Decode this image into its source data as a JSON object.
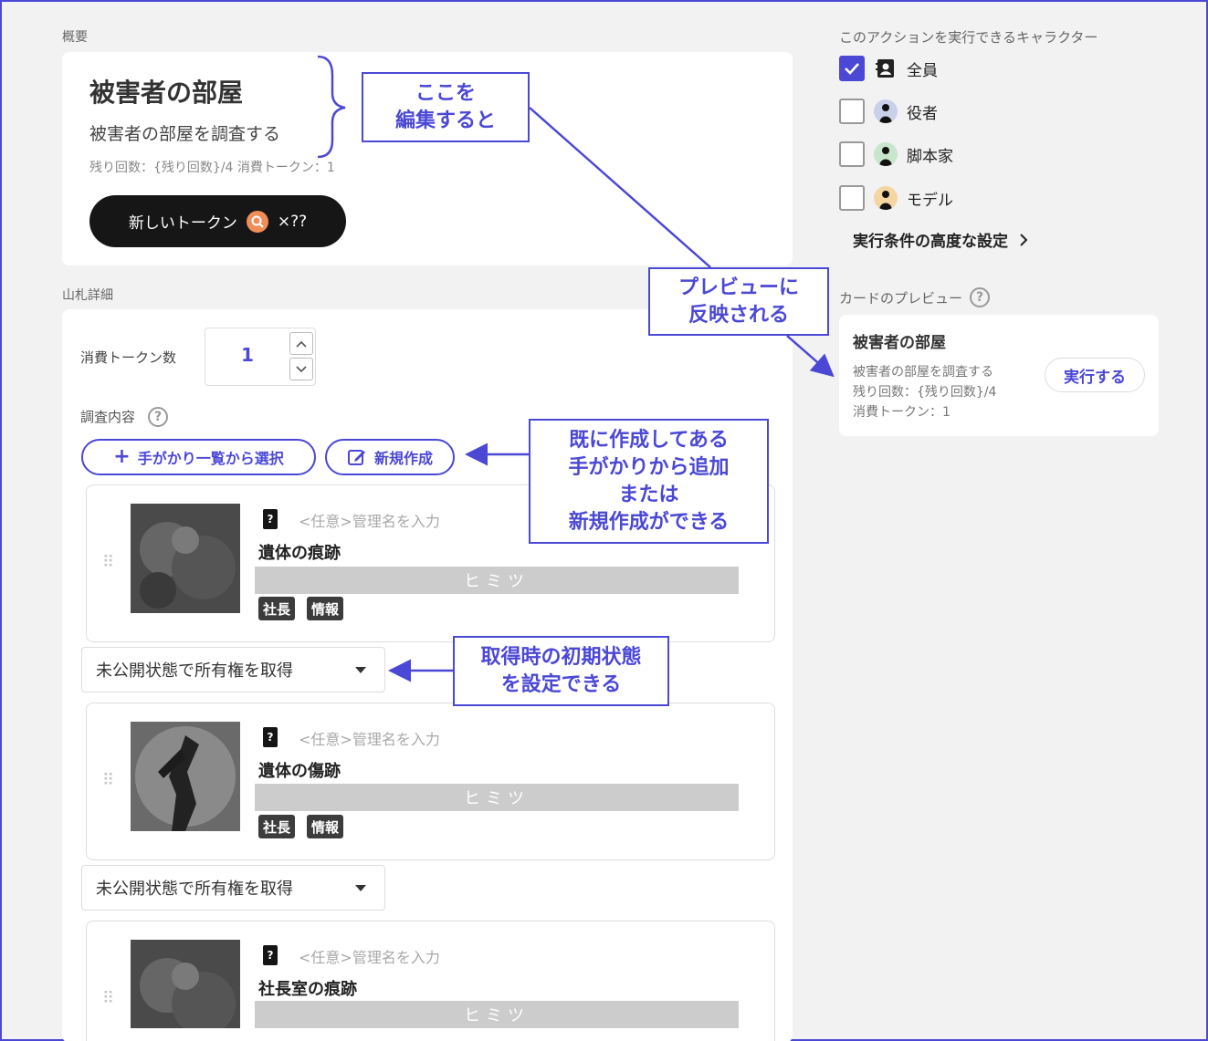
{
  "overview": {
    "section_label": "概要",
    "title": "被害者の部屋",
    "description": "被害者の部屋を調査する",
    "meta": "残り回数：{残り回数}/4 消費トークン：1",
    "token_button": {
      "label": "新しいトークン",
      "count": "×??"
    }
  },
  "deck": {
    "section_label": "山札詳細",
    "consume_label": "消費トークン数",
    "consume_value": "1",
    "investigation_label": "調査内容",
    "help": "?",
    "select_button": "手がかり一覧から選択",
    "new_button": "新規作成",
    "clues": [
      {
        "badge": "?",
        "placeholder": "<任意>管理名を入力",
        "name": "遺体の痕跡",
        "secret": "ヒミツ",
        "tags": [
          "社長",
          "情報"
        ]
      },
      {
        "badge": "?",
        "placeholder": "<任意>管理名を入力",
        "name": "遺体の傷跡",
        "secret": "ヒミツ",
        "tags": [
          "社長",
          "情報"
        ]
      },
      {
        "badge": "?",
        "placeholder": "<任意>管理名を入力",
        "name": "社長室の痕跡",
        "secret": "ヒミツ",
        "tags": []
      }
    ],
    "state_selects": [
      "未公開状態で所有権を取得",
      "未公開状態で所有権を取得"
    ]
  },
  "characters": {
    "section_label": "このアクションを実行できるキャラクター",
    "items": [
      {
        "name": "全員",
        "checked": true,
        "icon": "contact-book-icon"
      },
      {
        "name": "役者",
        "checked": false,
        "color": "#c9d1ea"
      },
      {
        "name": "脚本家",
        "checked": false,
        "color": "#c7e6cc"
      },
      {
        "name": "モデル",
        "checked": false,
        "color": "#f5d6a3"
      }
    ],
    "advanced_link": "実行条件の高度な設定"
  },
  "preview": {
    "section_label": "カードのプレビュー",
    "help": "?",
    "title": "被害者の部屋",
    "lines": [
      "被害者の部屋を調査する",
      "残り回数：{残り回数}/4",
      "消費トークン：1"
    ],
    "button": "実行する"
  },
  "annotations": {
    "edit": [
      "ここを",
      "編集すると"
    ],
    "preview_reflect": [
      "プレビューに",
      "反映される"
    ],
    "add_clues": [
      "既に作成してある",
      "手がかりから追加",
      "または",
      "新規作成ができる"
    ],
    "initial_state": [
      "取得時の初期状態",
      "を設定できる"
    ]
  },
  "colors": {
    "accent": "#4b48d6",
    "token": "#f08d58",
    "dark_button": "#161616",
    "secret": "#cdcccc"
  }
}
